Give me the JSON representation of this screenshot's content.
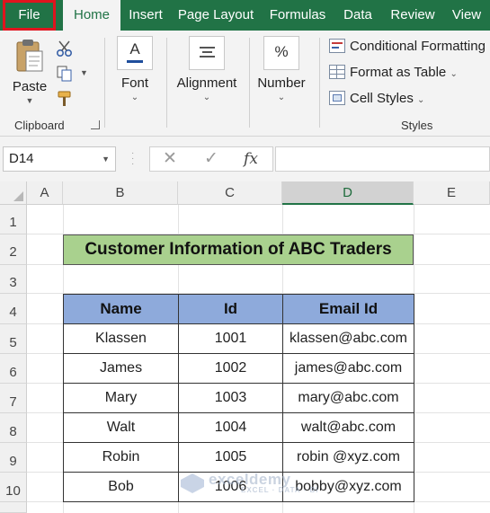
{
  "ribbon_tabs": {
    "file": "File",
    "home": "Home",
    "insert": "Insert",
    "page_layout": "Page Layout",
    "formulas": "Formulas",
    "data": "Data",
    "review": "Review",
    "view": "View"
  },
  "clipboard": {
    "paste_label": "Paste",
    "group_label": "Clipboard"
  },
  "font_group": {
    "label": "Font"
  },
  "alignment_group": {
    "label": "Alignment"
  },
  "number_group": {
    "label": "Number",
    "icon_text": "%"
  },
  "styles": {
    "conditional_formatting": "Conditional Formatting",
    "format_as_table": "Format as Table",
    "cell_styles": "Cell Styles",
    "group_label": "Styles"
  },
  "formula_bar": {
    "name_box": "D14",
    "cancel_glyph": "✕",
    "enter_glyph": "✓",
    "fx_glyph": "fx",
    "formula_value": ""
  },
  "columns": [
    "A",
    "B",
    "C",
    "D",
    "E"
  ],
  "selected_column": "D",
  "rows": [
    "1",
    "2",
    "3",
    "4",
    "5",
    "6",
    "7",
    "8",
    "9",
    "10"
  ],
  "sheet": {
    "title": "Customer Information of ABC Traders",
    "headers": [
      "Name",
      "Id",
      "Email Id"
    ],
    "records": [
      [
        "Klassen",
        "1001",
        "klassen@abc.com"
      ],
      [
        "James",
        "1002",
        "james@abc.com"
      ],
      [
        "Mary",
        "1003",
        "mary@abc.com"
      ],
      [
        "Walt",
        "1004",
        "walt@abc.com"
      ],
      [
        "Robin",
        "1005",
        "robin @xyz.com"
      ],
      [
        "Bob",
        "1006",
        "bobby@xyz.com"
      ]
    ]
  },
  "watermark": {
    "brand": "exceldemy",
    "tagline": "EXCEL · DATA · BI"
  },
  "colors": {
    "ribbon_green": "#217346",
    "file_highlight": "#e0141e",
    "title_fill": "#a9d18e",
    "header_fill": "#8eaadb"
  }
}
